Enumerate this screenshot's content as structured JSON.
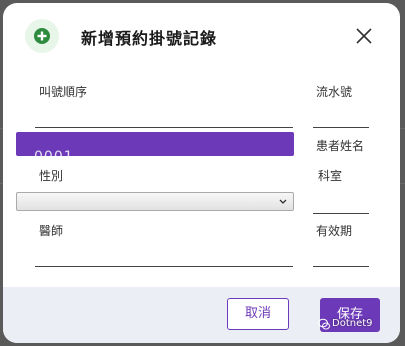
{
  "dialog": {
    "title": "新增預約掛號記錄",
    "header_icon": "plus-circle-icon",
    "close_icon": "close-icon"
  },
  "form": {
    "queue_order": {
      "label": "叫號順序",
      "value": ""
    },
    "serial_no": {
      "label": "流水號",
      "value": ""
    },
    "patient_name": {
      "label": "患者姓名"
    },
    "department": {
      "label": "科室",
      "value": ""
    },
    "gender": {
      "label": "性別",
      "value": ""
    },
    "doctor": {
      "label": "醫師",
      "value": ""
    },
    "valid_period": {
      "label": "有效期",
      "value": ""
    }
  },
  "suggestion": {
    "text": "0001"
  },
  "footer": {
    "cancel_label": "取消",
    "save_label": "保存"
  },
  "watermark": {
    "text": "Dotnet9"
  },
  "colors": {
    "accent": "#6c3ab8",
    "icon_green": "#2e8b3e",
    "footer_bg": "#eceef5",
    "backdrop": "#5a5a5a"
  }
}
